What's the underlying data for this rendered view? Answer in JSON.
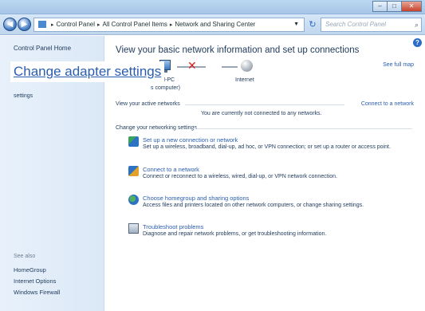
{
  "titlebar": {
    "buttons": [
      {
        "name": "minimize",
        "glyph": "–"
      },
      {
        "name": "maximize",
        "glyph": "□"
      },
      {
        "name": "close",
        "glyph": "✕"
      }
    ]
  },
  "address": {
    "breadcrumbs": [
      "Control Panel",
      "All Control Panel Items",
      "Network and Sharing Center"
    ],
    "search_placeholder": "Search Control Panel"
  },
  "left": {
    "home": "Control Panel Home",
    "item_partial": "settings",
    "see_also_label": "See also",
    "see_also": [
      "HomeGroup",
      "Internet Options",
      "Windows Firewall"
    ]
  },
  "overlay_link": "Change adapter settings",
  "main": {
    "heading": "View your basic network information and set up connections",
    "see_full_map": "See full map",
    "map": {
      "pc_name": "H-PC",
      "pc_sub": "s computer)",
      "internet": "Internet"
    },
    "active_label": "View your active networks",
    "connect_link": "Connect to a network",
    "no_network": "You are currently not connected to any networks.",
    "change_label": "Change your networking settings",
    "tasks": [
      {
        "title": "Set up a new connection or network",
        "desc": "Set up a wireless, broadband, dial-up, ad hoc, or VPN connection; or set up a router or access point.",
        "icon": "new-connection-icon"
      },
      {
        "title": "Connect to a network",
        "desc": "Connect or reconnect to a wireless, wired, dial-up, or VPN network connection.",
        "icon": "connect-network-icon"
      },
      {
        "title": "Choose homegroup and sharing options",
        "desc": "Access files and printers located on other network computers, or change sharing settings.",
        "icon": "homegroup-icon"
      },
      {
        "title": "Troubleshoot problems",
        "desc": "Diagnose and repair network problems, or get troubleshooting information.",
        "icon": "troubleshoot-icon"
      }
    ]
  }
}
